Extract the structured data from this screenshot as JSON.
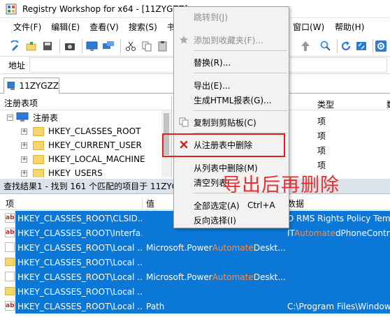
{
  "window": {
    "title": "Registry Workshop for x64 - [11ZYGZZ]"
  },
  "menubar": [
    "文件(F)",
    "编辑(E)",
    "查看(V)",
    "搜索(S)",
    "书",
    "窗口(W)",
    "帮助(H)"
  ],
  "addressbar": {
    "label": "地址",
    "value": ""
  },
  "tab": {
    "label": "11ZYGZZ"
  },
  "tree": {
    "header": "注册表项",
    "root": "注册表",
    "items": [
      "HKEY_CLASSES_ROOT",
      "HKEY_CURRENT_USER",
      "HKEY_LOCAL_MACHINE",
      "HKEY_USERS"
    ]
  },
  "valuepane": {
    "col_type": "类型",
    "col_data": "数",
    "cells": [
      "项",
      "项",
      "项",
      "项"
    ]
  },
  "results": {
    "bar_text": "查找结果1 - 找到 161 个匹配的项目于 11ZYG",
    "headers": {
      "key": "项",
      "value": "值",
      "data": "数据"
    },
    "rows": [
      {
        "icon": "ab",
        "key": "HKEY_CLASSES_ROOT\\CLSID...",
        "value": "",
        "data_pre": "D RMS Rights Policy Tem",
        "data_hl": "",
        "data_post": ""
      },
      {
        "icon": "ab",
        "key": "HKEY_CLASSES_ROOT\\Interfa...",
        "value": "",
        "data_pre": "IT",
        "data_hl": "Automate",
        "data_post": "dPhoneControl"
      },
      {
        "icon": "doc",
        "key": "HKEY_CLASSES_ROOT\\Local ...",
        "value_pre": "Microsoft.Power",
        "value_hl": "Automate",
        "value_post": "Deskt...",
        "data_pre": "",
        "data_hl": "",
        "data_post": ""
      },
      {
        "icon": "fold",
        "key": "HKEY_CLASSES_ROOT\\Local ...",
        "value": "",
        "data_pre": "",
        "data_hl": "",
        "data_post": ""
      },
      {
        "icon": "doc",
        "key": "HKEY_CLASSES_ROOT\\Local ...",
        "value_pre": "Microsoft.Power",
        "value_hl": "Automate",
        "value_post": "Deskt...",
        "data_pre": "",
        "data_hl": "",
        "data_post": ""
      },
      {
        "icon": "fold",
        "key": "HKEY_CLASSES_ROOT\\Local ...",
        "value": "",
        "data_pre": "",
        "data_hl": "",
        "data_post": ""
      },
      {
        "icon": "ab",
        "key": "HKEY_CLASSES_ROOT\\Local ...",
        "value": "Path",
        "data_pre": "C:\\Program Files\\Window",
        "data_hl": "",
        "data_post": ""
      }
    ]
  },
  "context_menu": {
    "jump": "跳转到(J)",
    "favorite": "添加到收藏夹(F)...",
    "replace": "替换(R)...",
    "export": "导出(E)...",
    "html_report": "生成HTML报表(G)...",
    "copy": "复制到剪贴板(C)",
    "delete_registry": "从注册表中删除",
    "delete_list": "从列表中删除(M)",
    "clear_list": "清空列表(",
    "select_all": "全部选定(A)",
    "select_all_shortcut": "Ctrl+A",
    "invert": "反向选择(I)"
  },
  "annotation": "导出后再删除",
  "colors": {
    "selection": "#0b78d7",
    "highlight_text": "#ff8a40",
    "annotation": "#e53030",
    "delete_icon": "#d32020"
  }
}
